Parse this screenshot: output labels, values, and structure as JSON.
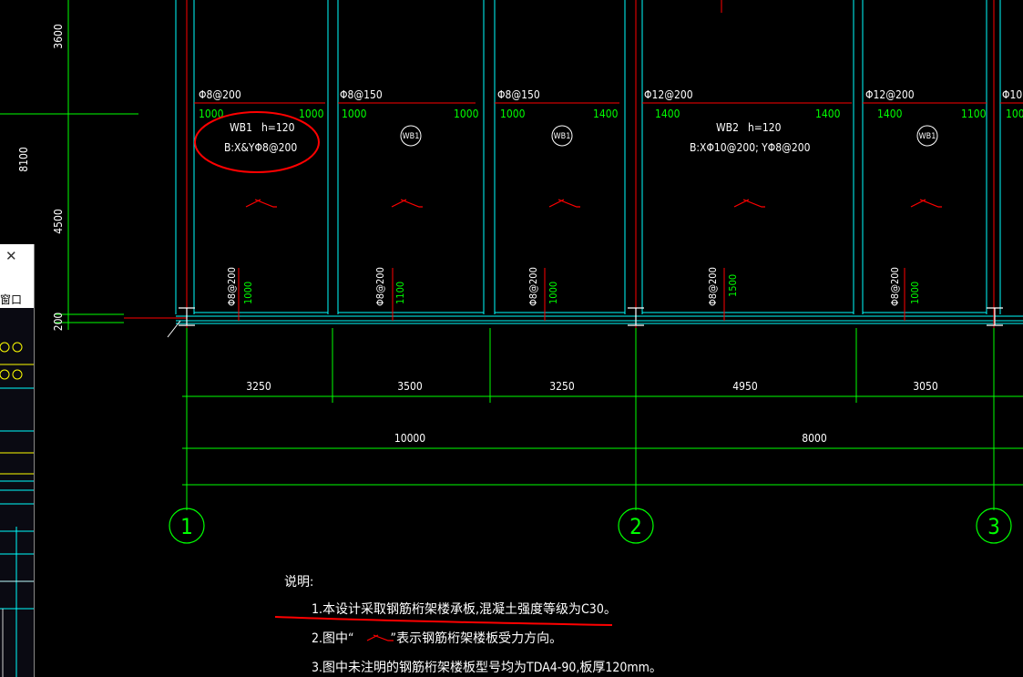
{
  "side_panel": {
    "close_icon": "close-icon",
    "title": "窗口"
  },
  "dims_left": {
    "d3600": "3600",
    "d8100": "8100",
    "d4500": "4500",
    "d200": "200"
  },
  "rebar_top": [
    {
      "label": "Φ8@200",
      "l": "1000",
      "r": "1000"
    },
    {
      "label": "Φ8@150",
      "l": "1000",
      "r": "1000"
    },
    {
      "label": "Φ8@150",
      "l": "1000",
      "r": "1400"
    },
    {
      "label": "Φ12@200",
      "l": "1400",
      "r": "1400"
    },
    {
      "label": "Φ12@200",
      "l": "1400",
      "r": "1100"
    },
    {
      "label": "Φ10",
      "l": "100"
    }
  ],
  "slabs": {
    "wb1": {
      "name": "WB1",
      "h": "h=120",
      "spec": "B:X&YΦ8@200"
    },
    "wb2": {
      "name": "WB2",
      "h": "h=120",
      "spec": "B:XΦ10@200; YΦ8@200"
    },
    "tag": "WB1"
  },
  "rebar_bottom": [
    {
      "label": "Φ8@200",
      "len": "1000"
    },
    {
      "label": "Φ8@200",
      "len": "1100"
    },
    {
      "label": "Φ8@200",
      "len": "1000"
    },
    {
      "label": "Φ8@200",
      "len": "1500"
    },
    {
      "label": "Φ8@200",
      "len": "1000"
    }
  ],
  "dims_bottom": {
    "d1": "3250",
    "d2": "3500",
    "d3": "3250",
    "d4": "4950",
    "d5": "3050",
    "t1": "10000",
    "t2": "8000"
  },
  "axes": [
    "1",
    "2",
    "3"
  ],
  "notes": {
    "title": "说明:",
    "n1": "1.本设计采取钢筋桁架楼承板,混凝土强度等级为C30。",
    "n2a": "2.图中“",
    "n2b": "”表示钢筋桁架楼板受力方向。",
    "n3": "3.图中未注明的钢筋桁架楼板型号均为TDA4-90,板厚120mm。"
  },
  "colors": {
    "green": "#00ff00",
    "cyan": "#00ffff",
    "red": "#ff0000",
    "white": "#ffffff",
    "yellow": "#ffff00"
  }
}
